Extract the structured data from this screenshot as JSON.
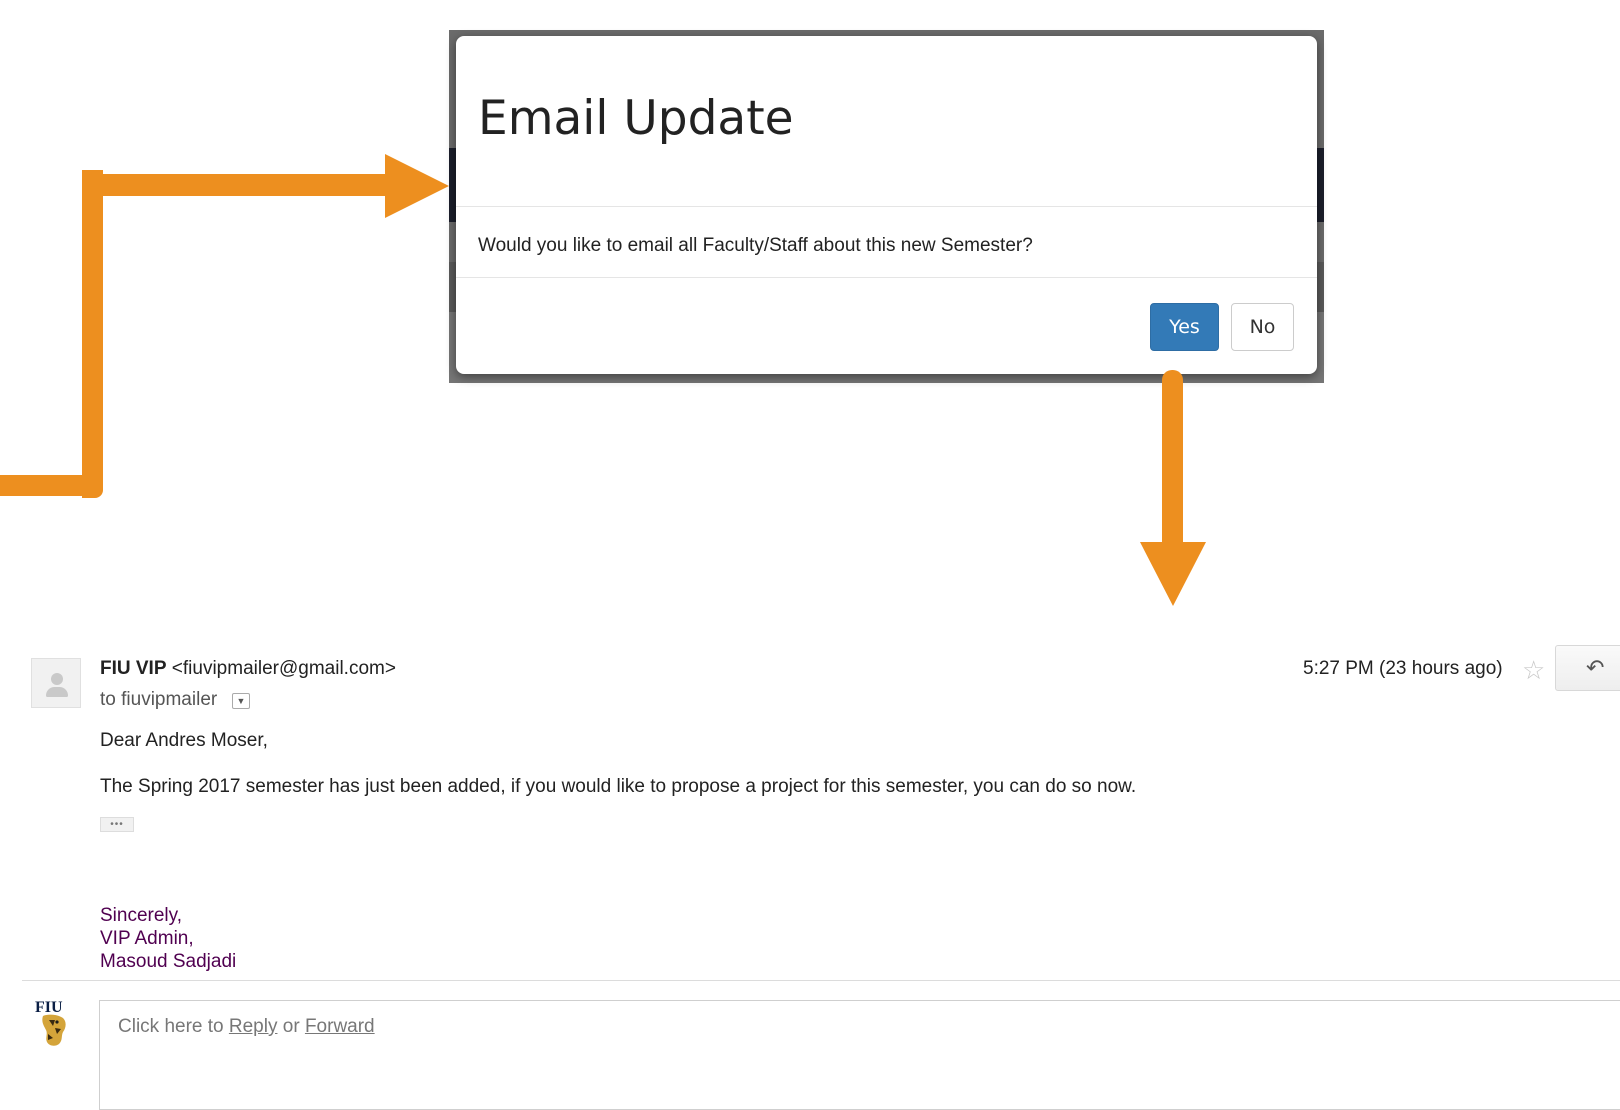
{
  "colors": {
    "arrow": "#ED8F1F",
    "primary_button": "#337ab7",
    "signature": "#500050"
  },
  "modal": {
    "title": "Email Update",
    "message": "Would you like to email all Faculty/Staff about this new Semester?",
    "yes_label": "Yes",
    "no_label": "No"
  },
  "email": {
    "sender_name": "FIU VIP",
    "sender_address": "<fiuvipmailer@gmail.com>",
    "to_line": "to fiuvipmailer",
    "timestamp": "5:27 PM (23 hours ago)",
    "greeting": "Dear Andres Moser,",
    "body": "The Spring 2017 semester has just been added, if you would like to propose a project for this semester, you can do so now.",
    "ellipsis": "•••",
    "signature": [
      "Sincerely,",
      "VIP Admin,",
      "Masoud Sadjadi"
    ],
    "icons": {
      "avatar": "person-icon",
      "star": "star-icon",
      "reply": "reply-arrow-icon",
      "dropdown": "chevron-down-icon"
    }
  },
  "reply_box": {
    "prefix": "Click here to",
    "reply_link": "Reply",
    "or": "or",
    "forward_link": "Forward",
    "logo_text": "FIU"
  }
}
